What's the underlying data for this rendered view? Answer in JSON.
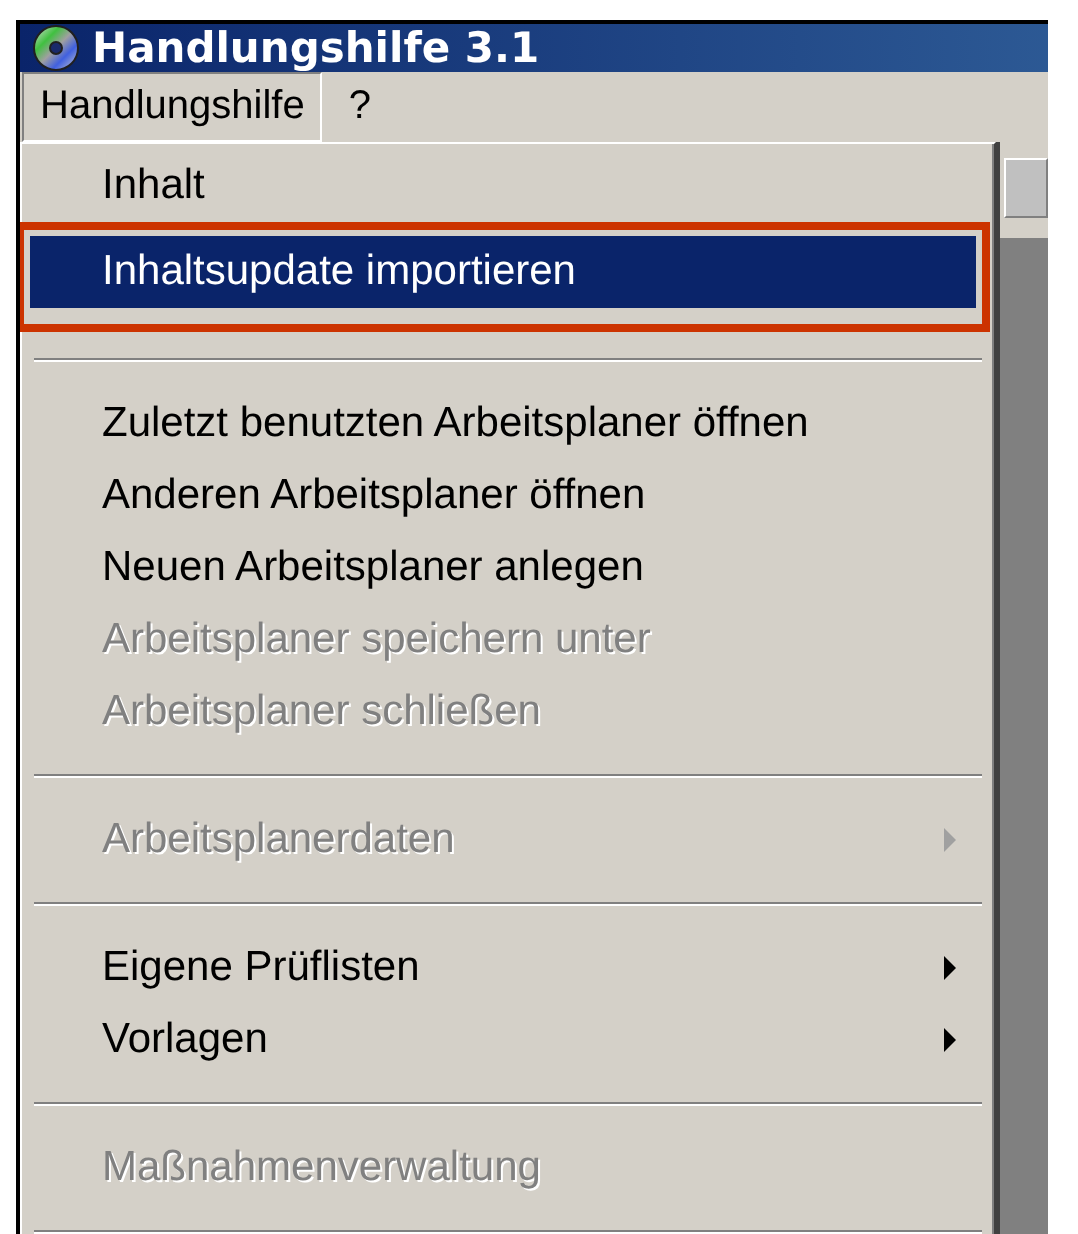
{
  "window": {
    "title": "Handlungshilfe 3.1"
  },
  "menu_bar": [
    {
      "label": "Handlungshilfe",
      "selected": true
    },
    {
      "label": "?",
      "selected": false
    }
  ],
  "menu": [
    {
      "kind": "item",
      "label": "Inhalt",
      "disabled": false,
      "selected": false,
      "submenu": false,
      "outlined": false
    },
    {
      "kind": "item",
      "label": "Inhaltsupdate importieren",
      "disabled": false,
      "selected": true,
      "submenu": false,
      "outlined": true
    },
    {
      "kind": "separator"
    },
    {
      "kind": "item",
      "label": "Zuletzt benutzten Arbeitsplaner öffnen",
      "disabled": false,
      "selected": false,
      "submenu": false,
      "outlined": false
    },
    {
      "kind": "item",
      "label": "Anderen Arbeitsplaner öffnen",
      "disabled": false,
      "selected": false,
      "submenu": false,
      "outlined": false
    },
    {
      "kind": "item",
      "label": "Neuen Arbeitsplaner anlegen",
      "disabled": false,
      "selected": false,
      "submenu": false,
      "outlined": false
    },
    {
      "kind": "item",
      "label": "Arbeitsplaner speichern unter",
      "disabled": true,
      "selected": false,
      "submenu": false,
      "outlined": false
    },
    {
      "kind": "item",
      "label": "Arbeitsplaner schließen",
      "disabled": true,
      "selected": false,
      "submenu": false,
      "outlined": false
    },
    {
      "kind": "separator"
    },
    {
      "kind": "item",
      "label": "Arbeitsplanerdaten",
      "disabled": true,
      "selected": false,
      "submenu": true,
      "outlined": false
    },
    {
      "kind": "separator"
    },
    {
      "kind": "item",
      "label": "Eigene Prüflisten",
      "disabled": false,
      "selected": false,
      "submenu": true,
      "outlined": false
    },
    {
      "kind": "item",
      "label": "Vorlagen",
      "disabled": false,
      "selected": false,
      "submenu": true,
      "outlined": false
    },
    {
      "kind": "separator"
    },
    {
      "kind": "item",
      "label": "Maßnahmenverwaltung",
      "disabled": true,
      "selected": false,
      "submenu": false,
      "outlined": false
    },
    {
      "kind": "separator"
    }
  ]
}
